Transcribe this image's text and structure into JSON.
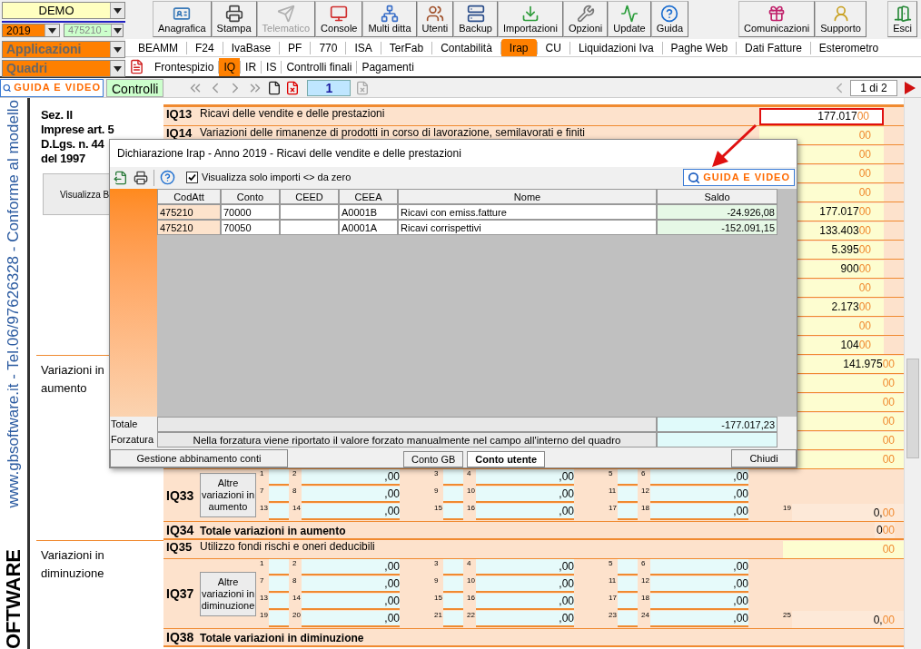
{
  "selectors": {
    "company": "DEMO",
    "year": "2019",
    "activity": "475210 -",
    "applications": "Applicazioni",
    "sections": "Quadri"
  },
  "toolbar": {
    "main": [
      {
        "label": "Anagrafica",
        "disabled": false
      },
      {
        "label": "Stampa",
        "disabled": false
      },
      {
        "label": "Telematico",
        "disabled": true
      },
      {
        "label": "Console",
        "disabled": false
      },
      {
        "label": "Multi ditta",
        "disabled": false
      },
      {
        "label": "Utenti",
        "disabled": false
      },
      {
        "label": "Backup",
        "disabled": false
      },
      {
        "label": "Importazioni",
        "disabled": false
      },
      {
        "label": "Opzioni",
        "disabled": false
      },
      {
        "label": "Update",
        "disabled": false
      },
      {
        "label": "Guida",
        "disabled": false
      }
    ],
    "secondary": [
      {
        "label": "Comunicazioni",
        "disabled": false
      },
      {
        "label": "Supporto",
        "disabled": false
      }
    ],
    "exit": "Esci"
  },
  "app_tabs": [
    {
      "label": "BEAMM",
      "selected": false
    },
    {
      "label": "F24",
      "selected": false
    },
    {
      "label": "IvaBase",
      "selected": false
    },
    {
      "label": "PF",
      "selected": false
    },
    {
      "label": "770",
      "selected": false
    },
    {
      "label": "ISA",
      "selected": false
    },
    {
      "label": "TerFab",
      "selected": false
    },
    {
      "label": "Contabilità",
      "selected": false
    },
    {
      "label": "Irap",
      "selected": true
    },
    {
      "label": "CU",
      "selected": false
    },
    {
      "label": "Liquidazioni Iva",
      "selected": false
    },
    {
      "label": "Paghe Web",
      "selected": false
    },
    {
      "label": "Dati Fatture",
      "selected": false
    },
    {
      "label": "Esterometro",
      "selected": false
    }
  ],
  "quadri_tabs": [
    {
      "label": "Frontespizio",
      "selected": false
    },
    {
      "label": "IQ",
      "selected": true
    },
    {
      "label": "IR",
      "selected": false
    },
    {
      "label": "IS",
      "selected": false
    },
    {
      "label": "Controlli finali",
      "selected": false
    },
    {
      "label": "Pagamenti",
      "selected": false
    }
  ],
  "nav": {
    "guide_button": "GUIDA E VIDEO",
    "checks_button": "Controlli",
    "page": "1",
    "page_count": "1 di 2"
  },
  "side_text": {
    "contact": "www.gbsoftware.it - Tel.06/97626328 - Conforme al modello",
    "logo": "OFTWARE"
  },
  "form": [
    {
      "lines": [
        "Sez. II",
        "Imprese art. 5",
        "D.Lgs. n. 44",
        "del 1997"
      ],
      "button": "Visualizza B",
      "items": [
        {
          "kind": "line",
          "code": "IQ13",
          "label": "Ricavi delle vendite e delle prestazioni",
          "value": "177.017",
          "decimals": "00",
          "highlighted": true
        },
        {
          "kind": "line",
          "code": "IQ14",
          "label": "Variazioni delle rimanenze di prodotti in corso di lavorazione, semilavorati e finiti",
          "decimals": "00",
          "highlighted": false
        },
        {
          "kind": "line",
          "decimals": "00",
          "highlighted": false
        },
        {
          "kind": "line",
          "decimals": "00",
          "highlighted": false
        },
        {
          "kind": "line",
          "decimals": "00",
          "highlighted": false
        },
        {
          "kind": "line",
          "value": "177.017",
          "decimals": "00",
          "highlighted": false
        },
        {
          "kind": "line",
          "value": "133.403",
          "decimals": "00",
          "highlighted": false
        },
        {
          "kind": "line",
          "value": "5.395",
          "decimals": "00",
          "highlighted": false
        },
        {
          "kind": "line",
          "value": "900",
          "decimals": "00",
          "highlighted": false
        },
        {
          "kind": "line",
          "decimals": "00",
          "highlighted": false
        },
        {
          "kind": "line",
          "value": "2.173",
          "decimals": "00",
          "highlighted": false
        },
        {
          "kind": "line",
          "decimals": "00",
          "highlighted": false
        },
        {
          "kind": "line",
          "value": "104",
          "decimals": "00",
          "highlighted": false
        }
      ]
    },
    {
      "lines": [
        "Variazioni in aumento"
      ],
      "items": [
        {
          "kind": "line",
          "value": "141.975",
          "decimals": "00",
          "highlighted": false
        },
        {
          "kind": "line",
          "decimals": "00",
          "highlighted": false
        },
        {
          "kind": "line",
          "decimals": "00",
          "highlighted": false
        },
        {
          "kind": "line",
          "decimals": "00",
          "highlighted": false
        },
        {
          "kind": "line",
          "decimals": "00",
          "highlighted": false
        },
        {
          "kind": "line",
          "decimals": "00",
          "highlighted": false
        },
        {
          "kind": "grid",
          "code": "IQ33",
          "button": "Altre variazioni in aumento",
          "cells": [
            [
              {
                "n": "1"
              },
              {
                "n": "2",
                "amount": ",00"
              },
              {
                "n": "3"
              },
              {
                "n": "4",
                "amount": ",00"
              },
              {
                "n": "5"
              },
              {
                "n": "6",
                "amount": ",00"
              }
            ],
            [
              {
                "n": "7"
              },
              {
                "n": "8",
                "amount": ",00"
              },
              {
                "n": "9"
              },
              {
                "n": "10",
                "amount": ",00"
              },
              {
                "n": "11"
              },
              {
                "n": "12",
                "amount": ",00"
              }
            ],
            [
              {
                "n": "13"
              },
              {
                "n": "14",
                "amount": ",00"
              },
              {
                "n": "15"
              },
              {
                "n": "16",
                "amount": ",00"
              },
              {
                "n": "17"
              },
              {
                "n": "18",
                "amount": ",00"
              }
            ]
          ],
          "total": {
            "n": "19",
            "value": "0,",
            "decimals": "00"
          }
        },
        {
          "kind": "total",
          "code": "IQ34",
          "label": "Totale variazioni in aumento",
          "value": "0",
          "decimals": "00"
        }
      ]
    },
    {
      "lines": [
        "Variazioni in diminuzione"
      ],
      "items": [
        {
          "kind": "line",
          "code": "IQ35",
          "label": "Utilizzo fondi rischi e oneri deducibili",
          "decimals": "00",
          "highlighted": false
        },
        {
          "kind": "grid",
          "code": "IQ37",
          "button": "Altre variazioni in diminuzione",
          "cells": [
            [
              {
                "n": "1"
              },
              {
                "n": "2",
                "amount": ",00"
              },
              {
                "n": "3"
              },
              {
                "n": "4",
                "amount": ",00"
              },
              {
                "n": "5"
              },
              {
                "n": "6",
                "amount": ",00"
              }
            ],
            [
              {
                "n": "7"
              },
              {
                "n": "8",
                "amount": ",00"
              },
              {
                "n": "9"
              },
              {
                "n": "10",
                "amount": ",00"
              },
              {
                "n": "11"
              },
              {
                "n": "12",
                "amount": ",00"
              }
            ],
            [
              {
                "n": "13"
              },
              {
                "n": "14",
                "amount": ",00"
              },
              {
                "n": "15"
              },
              {
                "n": "16",
                "amount": ",00"
              },
              {
                "n": "17"
              },
              {
                "n": "18",
                "amount": ",00"
              }
            ],
            [
              {
                "n": "19"
              },
              {
                "n": "20",
                "amount": ",00"
              },
              {
                "n": "21"
              },
              {
                "n": "22",
                "amount": ",00"
              },
              {
                "n": "23"
              },
              {
                "n": "24",
                "amount": ",00"
              }
            ]
          ],
          "total": {
            "n": "25",
            "value": "0,",
            "decimals": "00"
          }
        },
        {
          "kind": "total",
          "code": "IQ38",
          "label": "Totale variazioni in diminuzione"
        }
      ]
    }
  ],
  "dialog": {
    "title": "Dichiarazione Irap - Anno 2019 - Ricavi delle vendite e delle prestazioni",
    "filter": {
      "label": "Visualizza solo importi <> da zero",
      "checked": true
    },
    "guide_button": "GUIDA E VIDEO",
    "columns": [
      "CodAtt",
      "Conto",
      "CEED",
      "CEEA",
      "Nome",
      "Saldo"
    ],
    "rows": [
      {
        "codatt": "475210",
        "conto": "70000",
        "ceea": "A0001B",
        "nome": "Ricavi con emiss.fatture",
        "saldo": "-24.926,08"
      },
      {
        "codatt": "475210",
        "conto": "70050",
        "ceea": "A0001A",
        "nome": "Ricavi corrispettivi",
        "saldo": "-152.091,15"
      }
    ],
    "total_label": "Totale",
    "total": "-177.017,23",
    "override_label": "Forzatura",
    "override_note": "Nella forzatura viene riportato il valore forzato manualmente nel campo all'interno del quadro",
    "manage_button": "Gestione abbinamento conti",
    "view_tabs": [
      {
        "label": "Conto GB",
        "selected": false
      },
      {
        "label": "Conto utente",
        "selected": true
      }
    ],
    "close_button": "Chiudi"
  }
}
